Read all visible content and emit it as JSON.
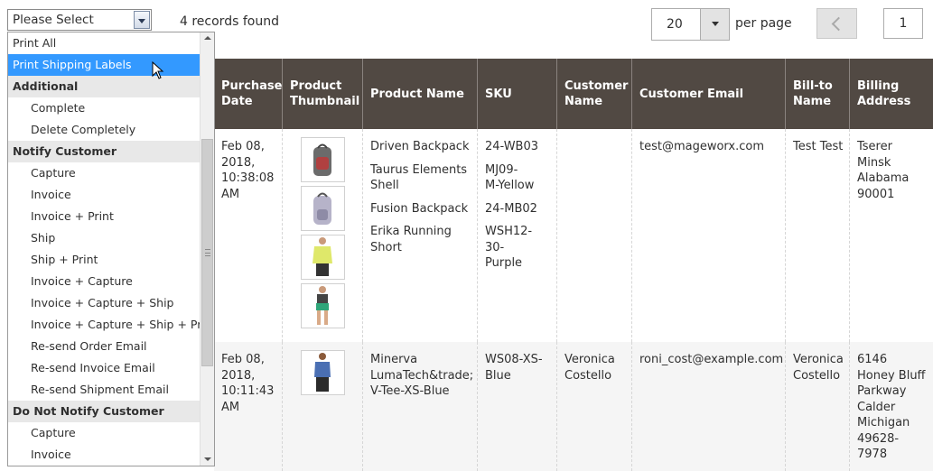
{
  "toolbar": {
    "actions_select_value": "Please Select",
    "records_found": "4 records found",
    "per_page_value": "20",
    "per_page_label": "per page",
    "page_number": "1"
  },
  "actions_dropdown": {
    "items": [
      {
        "label": "Print All",
        "kind": "top"
      },
      {
        "label": "Print Shipping Labels",
        "kind": "top",
        "highlighted": true
      },
      {
        "label": "Additional",
        "kind": "group"
      },
      {
        "label": "Complete",
        "kind": "sub"
      },
      {
        "label": "Delete Completely",
        "kind": "sub"
      },
      {
        "label": "Notify Customer",
        "kind": "group"
      },
      {
        "label": "Capture",
        "kind": "sub"
      },
      {
        "label": "Invoice",
        "kind": "sub"
      },
      {
        "label": "Invoice + Print",
        "kind": "sub"
      },
      {
        "label": "Ship",
        "kind": "sub"
      },
      {
        "label": "Ship + Print",
        "kind": "sub"
      },
      {
        "label": "Invoice + Capture",
        "kind": "sub"
      },
      {
        "label": "Invoice + Capture + Ship",
        "kind": "sub"
      },
      {
        "label": "Invoice + Capture + Ship + Print",
        "kind": "sub"
      },
      {
        "label": "Re-send Order Email",
        "kind": "sub"
      },
      {
        "label": "Re-send Invoice Email",
        "kind": "sub"
      },
      {
        "label": "Re-send Shipment Email",
        "kind": "sub"
      },
      {
        "label": "Do Not Notify Customer",
        "kind": "group"
      },
      {
        "label": "Capture",
        "kind": "sub"
      },
      {
        "label": "Invoice",
        "kind": "sub"
      }
    ]
  },
  "grid": {
    "columns": [
      "Purchase\nDate",
      "Product\nThumbnail",
      "Product Name",
      "SKU",
      "Customer\nName",
      "Customer Email",
      "Bill-to\nName",
      "Billing\nAddress"
    ],
    "rows": [
      {
        "purchase_date": "Feb 08,\n2018,\n10:38:08\nAM",
        "products": [
          {
            "name": "Driven Backpack",
            "sku": "24-WB03",
            "thumb": "gray-backpack"
          },
          {
            "name": "Taurus Elements\nShell",
            "sku": "MJ09-\nM-Yellow",
            "thumb": "lavender-backpack"
          },
          {
            "name": "Fusion Backpack",
            "sku": "24-MB02",
            "thumb": "yellow-jacket-person"
          },
          {
            "name": "Erika Running\nShort",
            "sku": "WSH12-30-\nPurple",
            "thumb": "green-shorts-person"
          }
        ],
        "customer_name": "",
        "customer_email": "test@mageworx.com",
        "bill_to_name": "Test Test",
        "billing_address": "Tserer\nMinsk\nAlabama\n90001"
      },
      {
        "purchase_date": "Feb 08,\n2018,\n10:11:43\nAM",
        "products": [
          {
            "name": "Minerva\nLumaTech&trade;\nV-Tee-XS-Blue",
            "sku": "WS08-XS-\nBlue",
            "thumb": "blue-tee-person"
          }
        ],
        "customer_name": "Veronica\nCostello",
        "customer_email": "roni_cost@example.com",
        "bill_to_name": "Veronica\nCostello",
        "billing_address": "6146\nHoney Bluff\nParkway\nCalder\nMichigan\n49628-7978"
      }
    ]
  },
  "colors": {
    "header_bg": "#514943",
    "highlight": "#3399ff",
    "group_bg": "#e8e8e8"
  }
}
